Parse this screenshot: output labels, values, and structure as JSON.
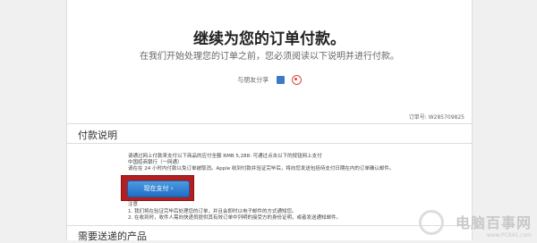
{
  "heading": {
    "title": "继续为您的订单付款。",
    "subtitle": "在我们开始处理您的订单之前，您必须阅读以下说明并进行付款。"
  },
  "share": {
    "label": "与朋友分享",
    "icons": [
      "mail-icon",
      "weibo-icon"
    ]
  },
  "order": {
    "number_label": "订单号: W285709825"
  },
  "payment": {
    "section_title": "付款说明",
    "line1": "请通过网上付款来支付以下商品的应付全额 RMB 5,288: 可通过点击以下的按钮网上支付",
    "line2": "中国招商银行（一网通）",
    "line3": "请在在 24 小时内付款以免订单被取消。Apple 收到付款并验证完毕后，将向您发送包括待支付日期在内的订单确认邮件。",
    "pay_button": "现在支付 ›",
    "note_title": "注意",
    "note1": "1. 我们将在验证完毕后处理您的订单，并且会即时以电子邮件的方式通知您。",
    "note2": "2. 在收到时，收件人需向快递员提供其有效订单中列明的接受方的身份证明，或者发送通知邮件。"
  },
  "items_section": {
    "title": "需要送递的产品"
  },
  "watermark": {
    "brand": "电脑百事网",
    "url": "www.PC841.com"
  }
}
